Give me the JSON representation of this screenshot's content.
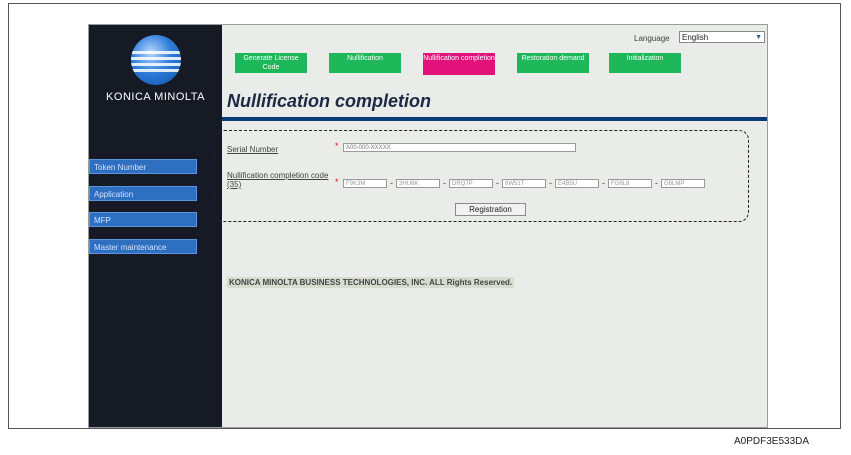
{
  "app": {
    "logo_text": "KONICA MINOLTA",
    "page_title": "Nullification completion"
  },
  "language": {
    "label": "Language",
    "selected": "English"
  },
  "tabs": [
    {
      "label": "Generate License Code",
      "color": "#1eb85a",
      "active": false
    },
    {
      "label": "Nullification",
      "color": "#1eb85a",
      "active": false
    },
    {
      "label": "Nullification completion",
      "color": "#e3127a",
      "active": true
    },
    {
      "label": "Restoration demand",
      "color": "#1eb85a",
      "active": false
    },
    {
      "label": "Initialization",
      "color": "#1eb85a",
      "active": false
    }
  ],
  "sidebar": {
    "items": [
      {
        "label": "Token Number"
      },
      {
        "label": "Application"
      },
      {
        "label": "MFP"
      },
      {
        "label": "Master maintenance"
      }
    ]
  },
  "form": {
    "serial_label": "Serial Number",
    "serial_value": "A00-000-XXXXX",
    "code_label": "Nullification completion code (35)",
    "code_values": [
      "F9K3M",
      "3HU6K",
      "DRQ7P",
      "8W51T",
      "E4B5U",
      "FG6L8",
      "G6LMP"
    ],
    "register_label": "Registration",
    "required_mark": "*"
  },
  "footer": {
    "copyright": "KONICA MINOLTA BUSINESS TECHNOLOGIES, INC.  ALL Rights Reserved."
  },
  "caption": "A0PDF3E533DA"
}
